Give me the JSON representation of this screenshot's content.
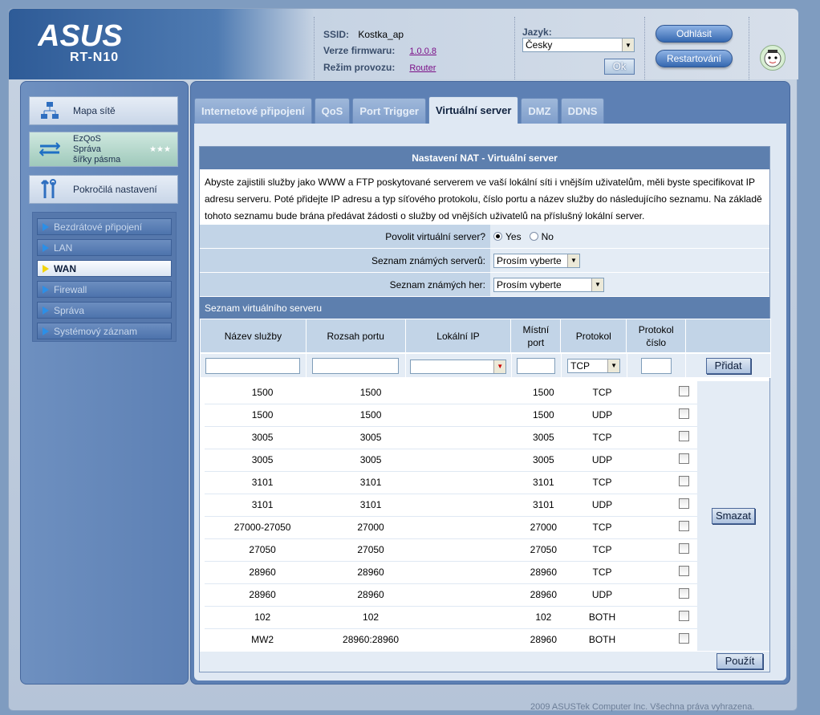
{
  "brand": {
    "logo_text": "ASUS",
    "model": "RT-N10"
  },
  "info": {
    "ssid_label": "SSID:",
    "ssid_value": "Kostka_ap",
    "firmware_label": "Verze firmwaru:",
    "firmware_value": "1.0.0.8",
    "mode_label": "Režim provozu:",
    "mode_value": "Router"
  },
  "language": {
    "label": "Jazyk:",
    "selected": "Česky",
    "ok_label": "Ok"
  },
  "header_buttons": {
    "logout": "Odhlásit",
    "restart": "Restartování"
  },
  "sidebar": {
    "main_items": [
      {
        "label": "Mapa sítě",
        "icon": "network-map-icon"
      },
      {
        "label": "EzQoS\nSpráva\nšířky pásma",
        "icon": "bandwidth-icon"
      },
      {
        "label": "Pokročilá nastavení",
        "icon": "tools-icon"
      }
    ],
    "sub_items": [
      {
        "label": "Bezdrátové připojení"
      },
      {
        "label": "LAN"
      },
      {
        "label": "WAN"
      },
      {
        "label": "Firewall"
      },
      {
        "label": "Správa"
      },
      {
        "label": "Systémový záznam"
      }
    ]
  },
  "tabs": [
    "Internetové připojení",
    "QoS",
    "Port Trigger",
    "Virtuální server",
    "DMZ",
    "DDNS"
  ],
  "active_tab": "Virtuální server",
  "panel": {
    "title": "Nastavení NAT - Virtuální server",
    "description": "Abyste zajistili služby jako WWW a FTP poskytované serverem ve vaší lokální síti i vnějším uživatelům, měli byste specifikovat IP adresu serveru. Poté přidejte IP adresu a typ síťového protokolu, číslo portu a název služby do následujícího seznamu. Na základě tohoto seznamu bude brána předávat žádosti o služby od vnějších uživatelů na příslušný lokální server.",
    "enable_label": "Povolit virtuální server?",
    "yes_label": "Yes",
    "no_label": "No",
    "known_servers_label": "Seznam známých serverů:",
    "known_games_label": "Seznam známých her:",
    "select_placeholder": "Prosím vyberte",
    "list_title": "Seznam virtuálního serveru"
  },
  "columns": {
    "service": "Název služby",
    "port_range": "Rozsah portu",
    "local_ip": "Lokální IP",
    "local_port_1": "Místní",
    "local_port_2": "port",
    "protocol": "Protokol",
    "protocol_num_1": "Protokol",
    "protocol_num_2": "číslo"
  },
  "input_row": {
    "protocol_default": "TCP",
    "add_label": "Přidat"
  },
  "rows": [
    {
      "service": "1500",
      "port_range": "1500",
      "local_port": "1500",
      "protocol": "TCP"
    },
    {
      "service": "1500",
      "port_range": "1500",
      "local_port": "1500",
      "protocol": "UDP"
    },
    {
      "service": "3005",
      "port_range": "3005",
      "local_port": "3005",
      "protocol": "TCP"
    },
    {
      "service": "3005",
      "port_range": "3005",
      "local_port": "3005",
      "protocol": "UDP"
    },
    {
      "service": "3101",
      "port_range": "3101",
      "local_port": "3101",
      "protocol": "TCP"
    },
    {
      "service": "3101",
      "port_range": "3101",
      "local_port": "3101",
      "protocol": "UDP"
    },
    {
      "service": "27000-27050",
      "port_range": "27000",
      "local_port": "27000",
      "protocol": "TCP"
    },
    {
      "service": "27050",
      "port_range": "27050",
      "local_port": "27050",
      "protocol": "TCP"
    },
    {
      "service": "28960",
      "port_range": "28960",
      "local_port": "28960",
      "protocol": "TCP"
    },
    {
      "service": "28960",
      "port_range": "28960",
      "local_port": "28960",
      "protocol": "UDP"
    },
    {
      "service": "102",
      "port_range": "102",
      "local_port": "102",
      "protocol": "BOTH"
    },
    {
      "service": "MW2",
      "port_range": "28960:28960",
      "local_port": "28960",
      "protocol": "BOTH"
    }
  ],
  "delete_label": "Smazat",
  "apply_label": "Použít",
  "footer": "2009 ASUSTek Computer Inc. Všechna práva vyhrazena."
}
